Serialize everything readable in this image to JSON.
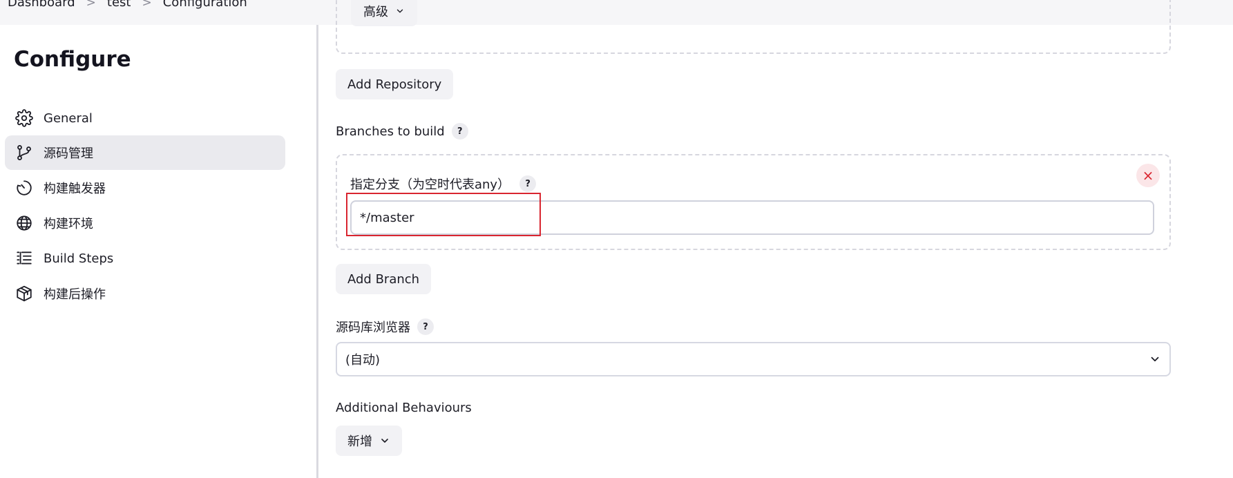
{
  "breadcrumb": {
    "items": [
      "Dashboard",
      "test",
      "Configuration"
    ],
    "separator": ">"
  },
  "sidebar": {
    "title": "Configure",
    "items": [
      {
        "label": "General",
        "icon": "gear-icon",
        "active": false
      },
      {
        "label": "源码管理",
        "icon": "git-branch-icon",
        "active": true
      },
      {
        "label": "构建触发器",
        "icon": "clock-icon",
        "active": false
      },
      {
        "label": "构建环境",
        "icon": "globe-icon",
        "active": false
      },
      {
        "label": "Build Steps",
        "icon": "list-icon",
        "active": false
      },
      {
        "label": "构建后操作",
        "icon": "package-icon",
        "active": false
      }
    ]
  },
  "main": {
    "advanced_button": "高级",
    "add_repository_button": "Add Repository",
    "branches_label": "Branches to build",
    "branch_specifier_label": "指定分支（为空时代表any）",
    "branch_specifier_value": "*/master",
    "add_branch_button": "Add Branch",
    "repo_browser_label": "源码库浏览器",
    "repo_browser_value": "(自动)",
    "additional_behaviours_label": "Additional Behaviours",
    "add_new_button": "新增",
    "help_glyph": "?",
    "remove_glyph": "×"
  },
  "colors": {
    "highlight": "#d9252f",
    "active_nav": "#eaeaee",
    "button_bg": "#f2f2f5"
  }
}
